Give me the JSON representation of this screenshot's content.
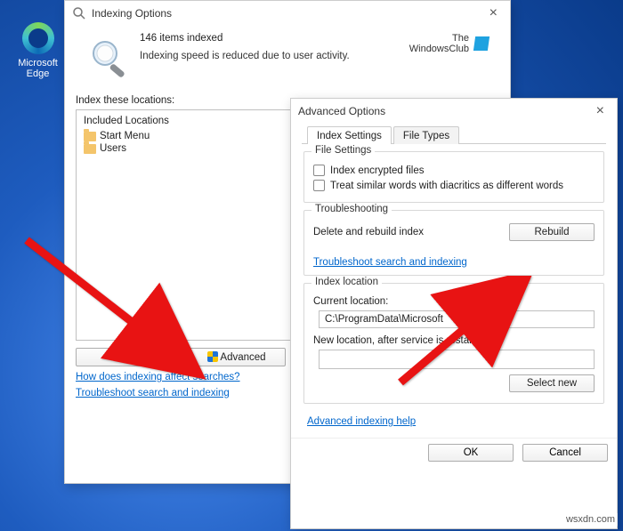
{
  "desktop": {
    "edge_label": "Microsoft Edge"
  },
  "indexing": {
    "title": "Indexing Options",
    "count": "146 items indexed",
    "note": "Indexing speed is reduced due to user activity.",
    "logo1": "The",
    "logo2": "WindowsClub",
    "locations_label": "Index these locations:",
    "col_included": "Included Locations",
    "items": [
      "Start Menu",
      "Users"
    ],
    "btn_modify": "Modify",
    "btn_advanced": "Advanced",
    "link1": "How does indexing affect searches?",
    "link2": "Troubleshoot search and indexing"
  },
  "advanced": {
    "title": "Advanced Options",
    "tab1": "Index Settings",
    "tab2": "File Types",
    "grp_file": "File Settings",
    "chk1": "Index encrypted files",
    "chk2": "Treat similar words with diacritics as different words",
    "grp_trouble": "Troubleshooting",
    "rebuild_label": "Delete and rebuild index",
    "btn_rebuild": "Rebuild",
    "link_trouble": "Troubleshoot search and indexing",
    "grp_loc": "Index location",
    "cur_label": "Current location:",
    "cur_value": "C:\\ProgramData\\Microsoft",
    "new_label": "New location, after service is restarted:",
    "new_value": "",
    "btn_select": "Select new",
    "link_help": "Advanced indexing help",
    "btn_ok": "OK",
    "btn_cancel": "Cancel"
  },
  "watermark": "wsxdn.com"
}
